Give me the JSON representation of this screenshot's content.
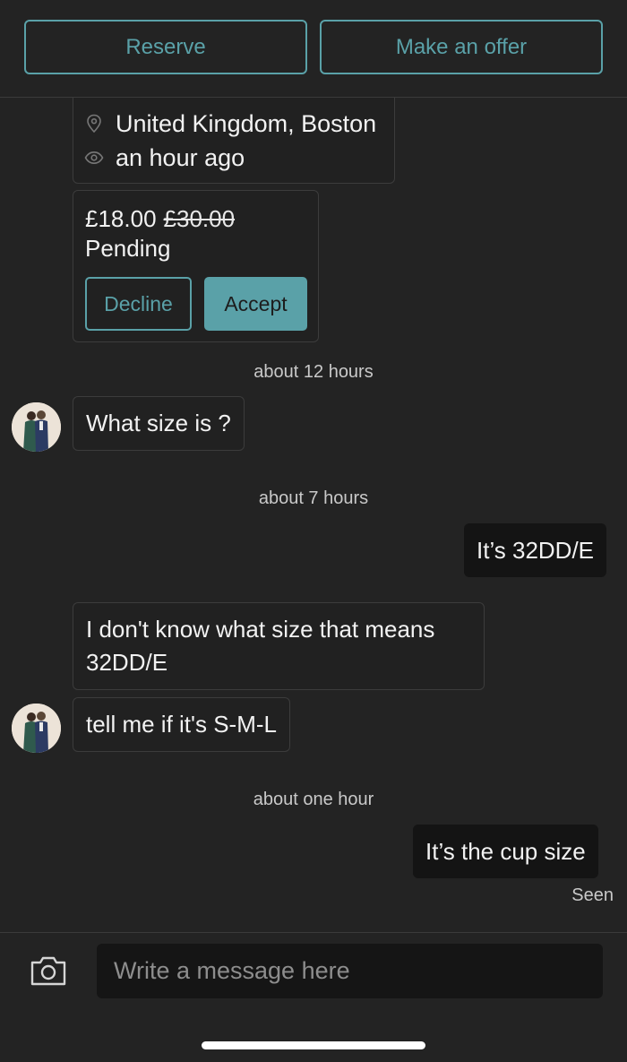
{
  "top_bar": {
    "reserve_label": "Reserve",
    "offer_label": "Make an offer"
  },
  "item": {
    "location": "United Kingdom, Boston",
    "viewed": "an hour ago",
    "location_icon": "map-pin-icon",
    "viewed_icon": "eye-icon"
  },
  "offer": {
    "price": "£18.00",
    "original_price": "£30.00",
    "status": "Pending",
    "decline_label": "Decline",
    "accept_label": "Accept"
  },
  "messages": {
    "ts_1": "about 12 hours",
    "msg_1": "What size is ?",
    "ts_2": "about 7 hours",
    "msg_2": "It’s 32DD/E",
    "msg_3": "I don't know what size that means 32DD/E",
    "msg_4": "tell me if it's S-M-L",
    "ts_3": "about one hour",
    "msg_5": "It’s the cup size",
    "seen": "Seen"
  },
  "composer": {
    "placeholder": "Write a message here",
    "camera_icon": "camera-icon"
  },
  "colors": {
    "background": "#232323",
    "accent": "#5aa1a8",
    "outgoing_bubble": "#141414"
  }
}
